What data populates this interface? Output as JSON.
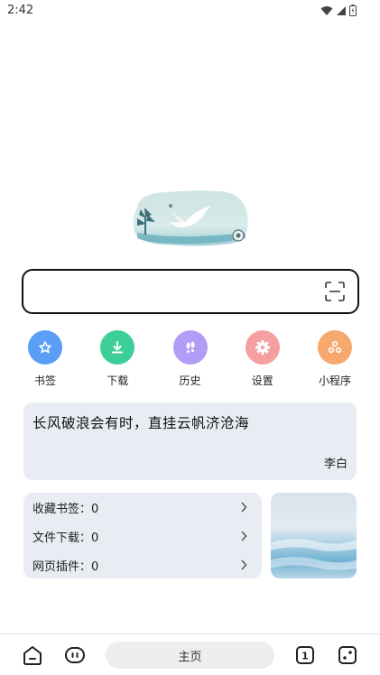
{
  "status": {
    "time": "2:42"
  },
  "shortcuts": [
    {
      "label": "书签",
      "icon": "bookmark-star-icon",
      "color": "#5b9ef5"
    },
    {
      "label": "下载",
      "icon": "download-icon",
      "color": "#3ccf98"
    },
    {
      "label": "历史",
      "icon": "history-footprint-icon",
      "color": "#b39cf5"
    },
    {
      "label": "设置",
      "icon": "gear-icon",
      "color": "#f5a0a0"
    },
    {
      "label": "小程序",
      "icon": "mini-program-icon",
      "color": "#f7a86e"
    }
  ],
  "quote": {
    "text": "长风破浪会有时，直挂云帆济沧海",
    "author": "李白"
  },
  "stats": [
    {
      "label": "收藏书签：0"
    },
    {
      "label": "文件下载：0"
    },
    {
      "label": "网页插件：0"
    }
  ],
  "bottom_nav": {
    "home_label": "主页",
    "tab_count": "1"
  }
}
